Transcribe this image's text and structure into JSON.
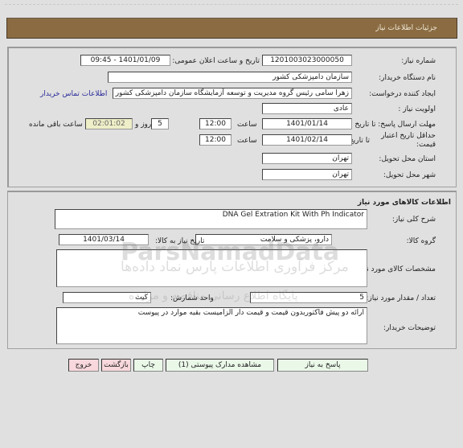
{
  "header": {
    "title": "جزئیات اطلاعات نیاز"
  },
  "need_info": {
    "need_number_label": "شماره نیاز:",
    "need_number": "1201003023000050",
    "announce_label": "تاریخ و ساعت اعلان عمومی:",
    "announce_value": "1401/01/09 - 09:45",
    "buyer_org_label": "نام دستگاه خریدار:",
    "buyer_org": "سازمان دامپزشکی کشور",
    "requester_label": "ایجاد کننده درخواست:",
    "requester": "زهرا سامی  رئیس گروه مدیریت و توسعه آزمایشگاه سازمان دامپزشکی کشور",
    "buyer_contact_link": "اطلاعات تماس خریدار",
    "priority_label": "اولویت نیاز :",
    "priority": "عادی",
    "reply_deadline_label": "مهلت ارسال پاسخ: تا تاریخ :",
    "reply_deadline_date": "1401/01/14",
    "time_label": "ساعت",
    "reply_deadline_time": "12:00",
    "days_value": "5",
    "days_and_label": "روز و",
    "remaining_time": "02:01:02",
    "remaining_label": "ساعت باقی مانده",
    "price_validity_label": "حداقل تاریخ اعتبار قیمت:",
    "price_validity_until_label": "تا تاریخ :",
    "price_validity_date": "1401/02/14",
    "price_validity_time": "12:00",
    "delivery_province_label": "استان محل تحویل:",
    "delivery_province": "تهران",
    "delivery_city_label": "شهر محل تحویل:",
    "delivery_city": "تهران"
  },
  "goods": {
    "section_title": "اطلاعات کالاهای مورد نیاز",
    "general_desc_label": "شرح کلی نیاز:",
    "general_desc": "DNA Gel Extration Kit With Ph Indicator",
    "goods_group_label": "گروه کالا:",
    "goods_group": "دارو، پزشکی و سلامت",
    "need_date_label": "تاریخ نیاز به کالا:",
    "need_date": "1401/03/14",
    "specs_label": "مشخصات کالای مورد نیاز:",
    "specs": "",
    "quantity_label": "تعداد / مقدار مورد نیاز:",
    "quantity": "5",
    "unit_label": "واحد شمارش:",
    "unit": "کیت",
    "buyer_notes_label": "توضیحات خریدار:",
    "buyer_notes": "ارائه دو پیش فاکتوربدون قیمت و قیمت دار الزامیست بقیه موارد در پیوست"
  },
  "buttons": {
    "reply": "پاسخ به نیاز",
    "view_attachments": "مشاهده مدارک پیوستی (1)",
    "print": "چاپ",
    "back": "بازگشت",
    "exit": "خروج"
  },
  "watermarks": {
    "brand": "ParsNamadData",
    "line1": "مرکز فرآوری اطلاعات پارس نماد داده‌ها",
    "line2": "پایگاه اطلاع رسانی مناقصه و مزایده"
  }
}
